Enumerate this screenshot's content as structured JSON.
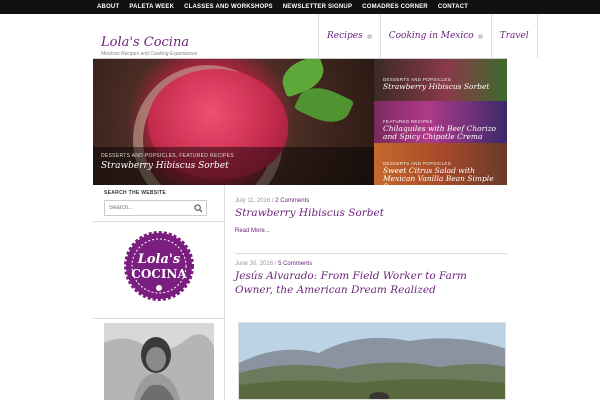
{
  "top_nav": [
    "ABOUT",
    "PALETA WEEK",
    "CLASSES AND WORKSHOPS",
    "NEWSLETTER SIGNUP",
    "COMADRES CORNER",
    "CONTACT"
  ],
  "site": {
    "title": "Lola's Cocina",
    "tagline": "Mexican Recipes and Cooking Experiences"
  },
  "main_nav": [
    {
      "label": "Recipes",
      "has_dropdown": true
    },
    {
      "label": "Cooking in Mexico",
      "has_dropdown": true
    },
    {
      "label": "Travel",
      "has_dropdown": false
    }
  ],
  "featured": {
    "category": "DESSERTS AND POPSICLES, FEATURED RECIPES",
    "title": "Strawberry Hibiscus Sorbet"
  },
  "slides": [
    {
      "category": "DESSERTS AND POPSICLES",
      "title": "Strawberry Hibiscus Sorbet"
    },
    {
      "category": "FEATURED RECIPES",
      "title": "Chilaquiles with Beef Chorizo and Spicy Chipotle Crema"
    },
    {
      "category": "DESSERTS AND POPSICLES",
      "title": "Sweet Citrus Salad with Mexican Vanilla Bean Simple Syrup"
    }
  ],
  "sidebar": {
    "search_label": "SEARCH THE WEBSITE",
    "search_placeholder": "Search...",
    "logo_text": "Lola's Cocina"
  },
  "posts": [
    {
      "date": "July 11, 2016",
      "comments": "2 Comments",
      "title": "Strawberry Hibiscus Sorbet",
      "read_more": "Read More..."
    },
    {
      "date": "June 30, 2016",
      "comments": "5 Comments",
      "title": "Jesús Alvarado: From Field Worker to Farm Owner, the American Dream Realized"
    }
  ],
  "colors": {
    "brand_purple": "#6b1f7a",
    "top_bar": "#111111"
  }
}
